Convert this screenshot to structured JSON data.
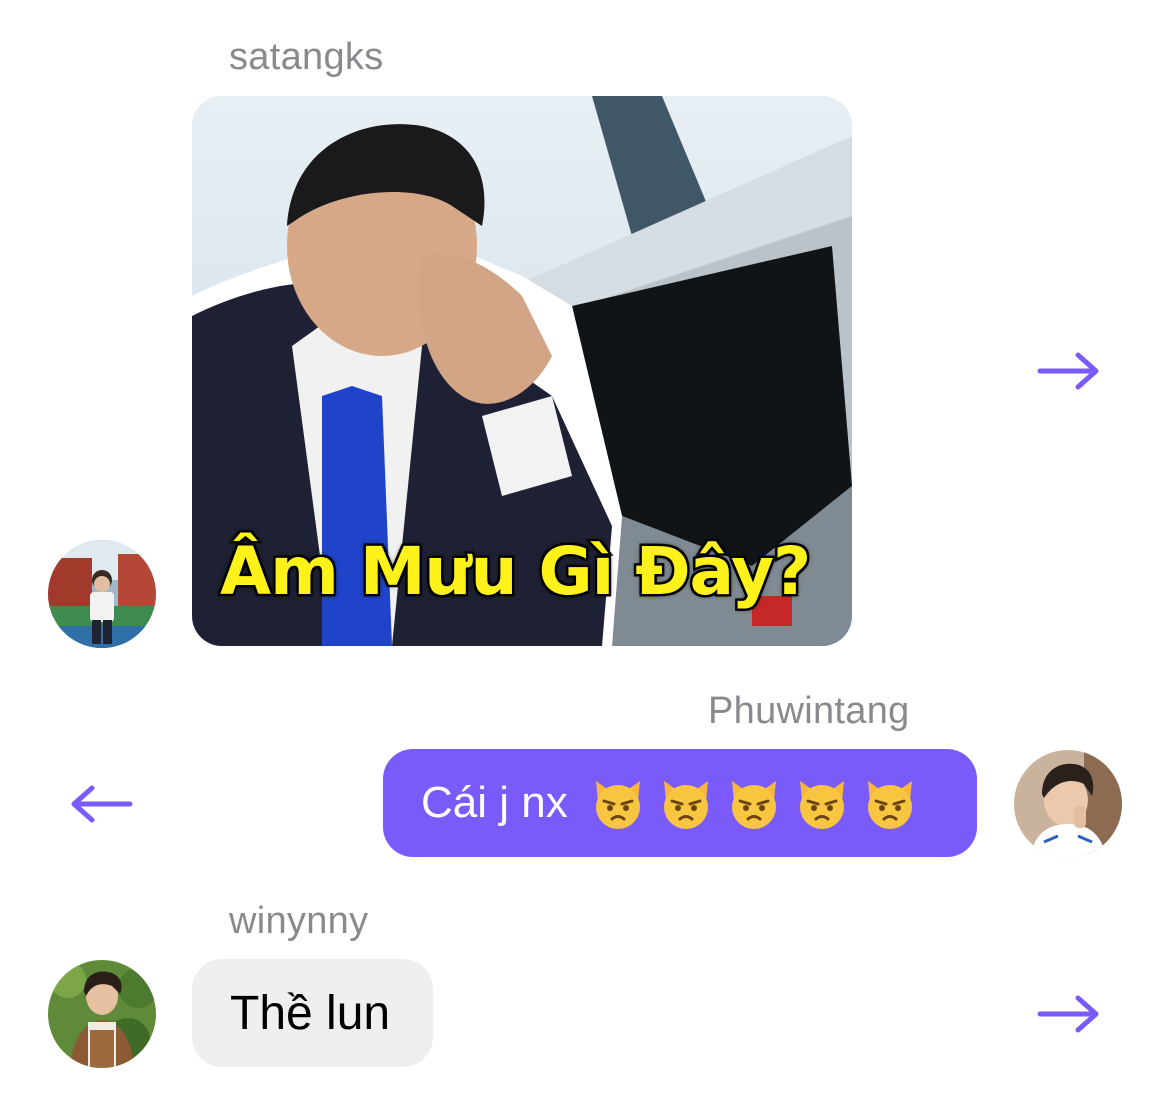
{
  "messages": [
    {
      "sender": "satangks",
      "type": "image",
      "caption": "Âm Mưu Gì Đây?",
      "action": "forward"
    },
    {
      "sender": "Phuwintang",
      "type": "text",
      "text": "Cái j nx",
      "emoji": [
        "pouting-cat-emoji",
        "pouting-cat-emoji",
        "pouting-cat-emoji",
        "pouting-cat-emoji",
        "pouting-cat-emoji"
      ],
      "action": "reply-back"
    },
    {
      "sender": "winynny",
      "type": "text",
      "text": "Thề lun",
      "action": "forward"
    }
  ],
  "colors": {
    "accent": "#7a5af8",
    "incoming_bubble": "#efeff1",
    "sender_name": "#8a8a8e",
    "caption_text": "#fff21a"
  },
  "icons": {
    "forward": "arrow-right-icon",
    "back": "arrow-left-icon"
  }
}
